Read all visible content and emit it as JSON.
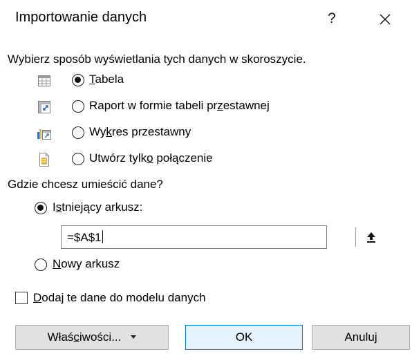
{
  "window": {
    "title": "Importowanie danych",
    "help_glyph": "?"
  },
  "display_section": {
    "heading": "Wybierz sposób wyświetlania tych danych w skoroszycie.",
    "options": [
      {
        "key": "T",
        "rest": "abela",
        "prefix": "",
        "icon": "table-icon",
        "selected": true
      },
      {
        "prefix": "Raport w formie tabeli pr",
        "key": "z",
        "rest": "estawnej",
        "icon": "pivot-table-icon",
        "selected": false
      },
      {
        "prefix": "Wy",
        "key": "k",
        "rest": "res przestawny",
        "icon": "pivot-chart-icon",
        "selected": false
      },
      {
        "prefix": "Utwórz tylk",
        "key": "o",
        "rest": " połączenie",
        "icon": "connection-only-icon",
        "selected": false
      }
    ]
  },
  "location_section": {
    "heading": "Gdzie chcesz umieścić dane?",
    "existing_sheet": {
      "prefix": "I",
      "key": "s",
      "rest": "tniejący arkusz:",
      "selected": true
    },
    "reference_value": "=$A$1",
    "new_sheet": {
      "prefix": "",
      "key": "N",
      "rest": "owy arkusz",
      "selected": false
    }
  },
  "data_model": {
    "prefix": "",
    "key": "D",
    "rest": "odaj te dane do modelu danych",
    "checked": false
  },
  "buttons": {
    "properties": {
      "prefix": "Właś",
      "key": "c",
      "rest": "iwości..."
    },
    "ok": "OK",
    "cancel": "Anuluj"
  },
  "colors": {
    "accent_border": "#0078d7",
    "default_button_bg": "#e5f1fb",
    "button_bg": "#e1e1e1",
    "icon_blue": "#2b73c7",
    "icon_gold": "#e8b33a"
  }
}
